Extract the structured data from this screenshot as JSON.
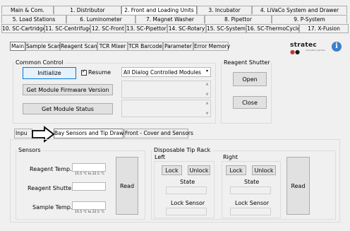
{
  "tab_rows": {
    "row1": [
      "Main & Com.",
      "1. Distributor",
      "2. Front and Loading Units",
      "3. Incubator",
      "4. LiVaCo System and Drawer"
    ],
    "row2": [
      "5. Load Stations",
      "6. Luminometer",
      "7. Magnet Washer",
      "8. Pipettor",
      "9. P-System"
    ],
    "row3": [
      "10. SC-Cartridge",
      "11. SC-Centrifuge",
      "12. SC-Front",
      "13. SC-Pipettor",
      "14. SC-Rotary",
      "15. SC-System",
      "16. SC-ThermoCycler",
      "17. X-Fusion"
    ]
  },
  "subtabs": [
    "Main",
    "Sample Scan",
    "Reagent Scan",
    "TCR Mixer",
    "TCR Barcode",
    "Parameter",
    "Error Memory"
  ],
  "logo": "stratec",
  "logo_tagline": "innovation partner",
  "icons": {
    "info": "info-icon",
    "arrow": "right-arrow-icon",
    "dropdown": "chevron-down-icon"
  },
  "common_control": {
    "title": "Common Control",
    "initialize": "Initialize",
    "resume_label": "Resume",
    "resume_checked": true,
    "module_select": "All Dialog Controlled Modules",
    "firmware_button": "Get Module Firmware Version",
    "status_button": "Get Module Status"
  },
  "reagent_shutter": {
    "title": "Reagent Shutter",
    "open": "Open",
    "close": "Close"
  },
  "inner_tabs": [
    "Inpu",
    "Bay Sensors and Tip Drawer",
    "Front - Cover and Sensors"
  ],
  "sensors": {
    "title": "Sensors",
    "reagent_temp": "Reagent Temp.",
    "reagent_temp_range": "15.5 °C to 22.5 °C",
    "reagent_shutter": "Reagent Shutter",
    "sample_temp": "Sample Temp.",
    "sample_temp_range": "15.5 °C to 22.5 °C",
    "read": "Read"
  },
  "tip_rack": {
    "title": "Disposable Tip Rack",
    "left": "Left",
    "right": "Right",
    "lock": "Lock",
    "unlock": "Unlock",
    "state": "State",
    "lock_sensor": "Lock Sensor",
    "read": "Read"
  }
}
